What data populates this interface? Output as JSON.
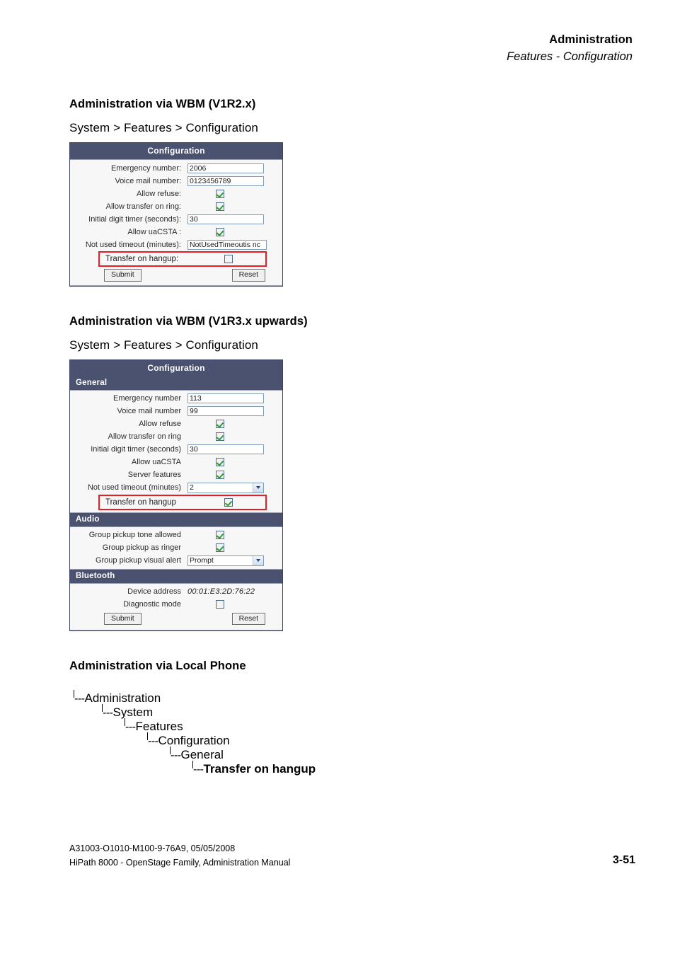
{
  "header": {
    "title": "Administration",
    "subtitle": "Features - Configuration"
  },
  "sections": {
    "wbm_v1r2": {
      "heading": "Administration via WBM (V1R2.x)",
      "breadcrumb": "System > Features > Configuration"
    },
    "wbm_v1r3": {
      "heading": "Administration via WBM (V1R3.x upwards)",
      "breadcrumb": "System > Features > Configuration"
    },
    "local_phone": {
      "heading": "Administration via Local Phone"
    }
  },
  "panel1": {
    "title": "Configuration",
    "fields": {
      "emergency_label": "Emergency number:",
      "emergency_value": "2006",
      "voicemail_label": "Voice mail number:",
      "voicemail_value": "0123456789",
      "allow_refuse_label": "Allow refuse:",
      "allow_transfer_label": "Allow transfer on ring:",
      "initial_digit_label": "Initial digit timer (seconds):",
      "initial_digit_value": "30",
      "uacsta_label": "Allow uaCSTA :",
      "not_used_label": "Not used timeout (minutes):",
      "not_used_value": "NotUsedTimeoutis nc",
      "transfer_hangup_label": "Transfer on hangup:"
    },
    "buttons": {
      "submit": "Submit",
      "reset": "Reset"
    }
  },
  "panel2": {
    "title": "Configuration",
    "groups": {
      "general": "General",
      "audio": "Audio",
      "bluetooth": "Bluetooth"
    },
    "general": {
      "emergency_label": "Emergency number",
      "emergency_value": "113",
      "voicemail_label": "Voice mail number",
      "voicemail_value": "99",
      "allow_refuse_label": "Allow refuse",
      "allow_transfer_label": "Allow transfer on ring",
      "initial_digit_label": "Initial digit timer (seconds)",
      "initial_digit_value": "30",
      "uacsta_label": "Allow uaCSTA",
      "server_features_label": "Server features",
      "not_used_label": "Not used timeout (minutes)",
      "not_used_value": "2",
      "transfer_hangup_label": "Transfer on hangup"
    },
    "audio": {
      "tone_allowed_label": "Group pickup tone allowed",
      "as_ringer_label": "Group pickup as ringer",
      "visual_alert_label": "Group pickup visual alert",
      "visual_alert_value": "Prompt"
    },
    "bluetooth": {
      "device_address_label": "Device address",
      "device_address_value": "00:01:E3:2D:76:22",
      "diagnostic_label": "Diagnostic mode"
    },
    "buttons": {
      "submit": "Submit",
      "reset": "Reset"
    }
  },
  "tree": {
    "dash": "---",
    "nodes": [
      "Administration",
      "System",
      "Features",
      "Configuration",
      "General",
      "Transfer on hangup"
    ]
  },
  "footer": {
    "line1": "A31003-O1010-M100-9-76A9, 05/05/2008",
    "line2": "HiPath 8000 - OpenStage Family, Administration Manual",
    "page": "3-51"
  },
  "colors": {
    "panel_header": "#4b5270",
    "highlight": "#ee1b22",
    "checkmark": "#2f9c3a"
  }
}
